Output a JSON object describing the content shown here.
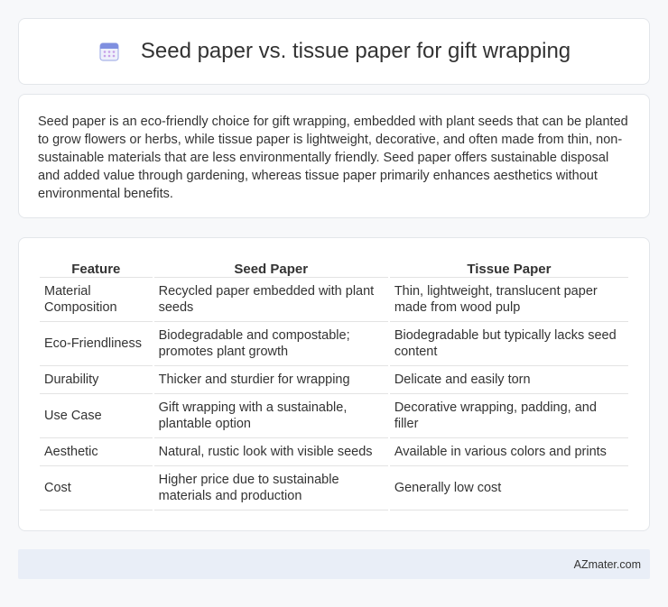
{
  "header": {
    "title": "Seed paper vs. tissue paper for gift wrapping",
    "icon": "calendar-icon"
  },
  "intro": {
    "text": "Seed paper is an eco-friendly choice for gift wrapping, embedded with plant seeds that can be planted to grow flowers or herbs, while tissue paper is lightweight, decorative, and often made from thin, non-sustainable materials that are less environmentally friendly. Seed paper offers sustainable disposal and added value through gardening, whereas tissue paper primarily enhances aesthetics without environmental benefits."
  },
  "table": {
    "headers": [
      "Feature",
      "Seed Paper",
      "Tissue Paper"
    ],
    "rows": [
      [
        "Material Composition",
        "Recycled paper embedded with plant seeds",
        "Thin, lightweight, translucent paper made from wood pulp"
      ],
      [
        "Eco-Friendliness",
        "Biodegradable and compostable; promotes plant growth",
        "Biodegradable but typically lacks seed content"
      ],
      [
        "Durability",
        "Thicker and sturdier for wrapping",
        "Delicate and easily torn"
      ],
      [
        "Use Case",
        "Gift wrapping with a sustainable, plantable option",
        "Decorative wrapping, padding, and filler"
      ],
      [
        "Aesthetic",
        "Natural, rustic look with visible seeds",
        "Available in various colors and prints"
      ],
      [
        "Cost",
        "Higher price due to sustainable materials and production",
        "Generally low cost"
      ]
    ]
  },
  "footer": {
    "text": "AZmater.com"
  }
}
